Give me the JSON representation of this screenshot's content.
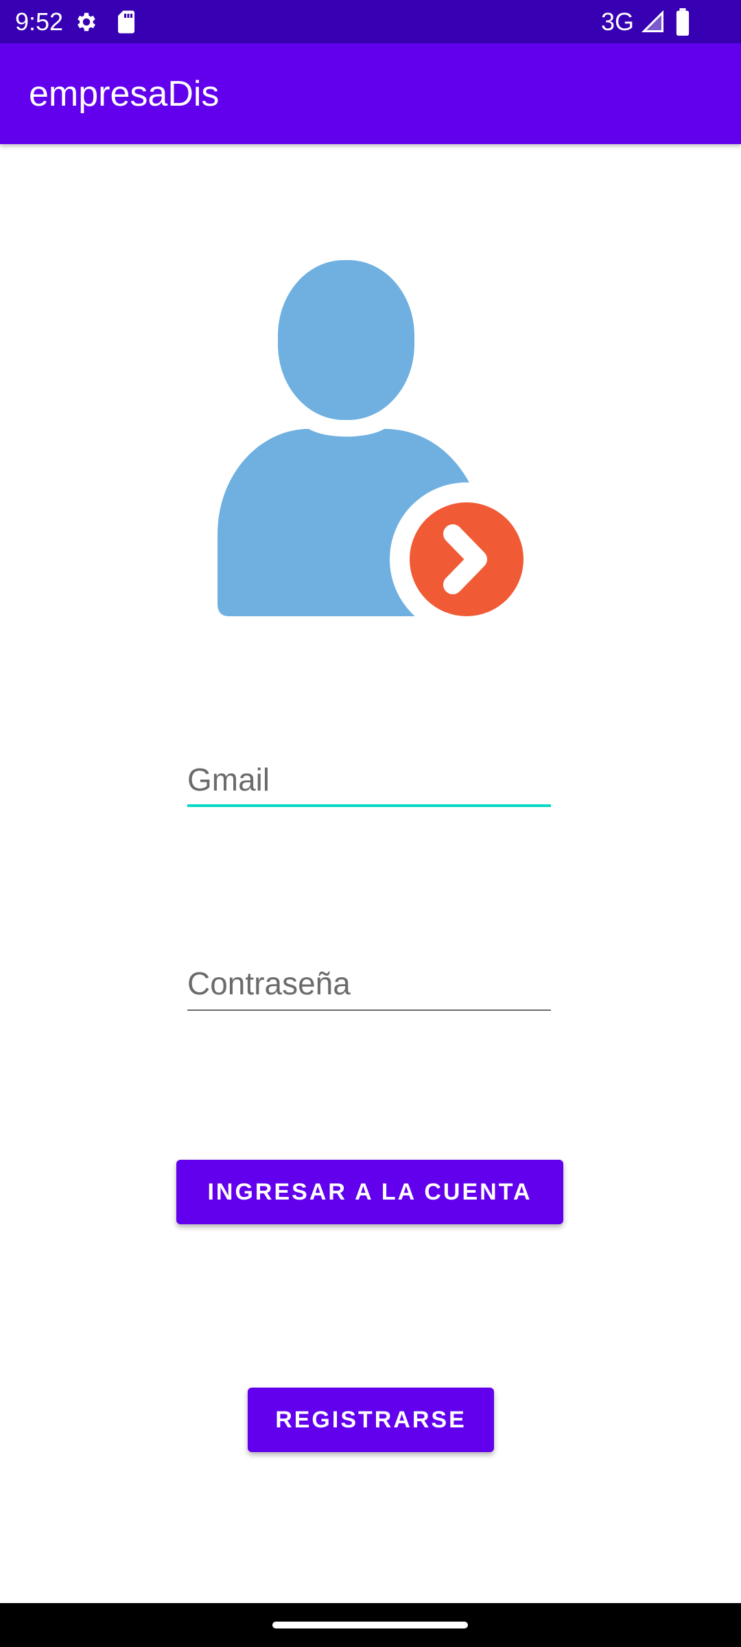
{
  "status_bar": {
    "time": "9:52",
    "network": "3G",
    "icons": [
      "gear-icon",
      "sd-card-icon",
      "signal-icon",
      "battery-icon"
    ],
    "background": "#3700b3"
  },
  "app_bar": {
    "title": "empresaDis",
    "background": "#6200ee"
  },
  "logo": {
    "icon": "user-login-icon",
    "person_color": "#6fb0e0",
    "badge_color": "#f05a35"
  },
  "form": {
    "email_placeholder": "Gmail",
    "email_value": "",
    "password_placeholder": "Contraseña",
    "password_value": "",
    "focus_color": "#03dac5"
  },
  "buttons": {
    "login_label": "INGRESAR A LA CUENTA",
    "register_label": "REGISTRARSE",
    "color": "#6200ee"
  }
}
